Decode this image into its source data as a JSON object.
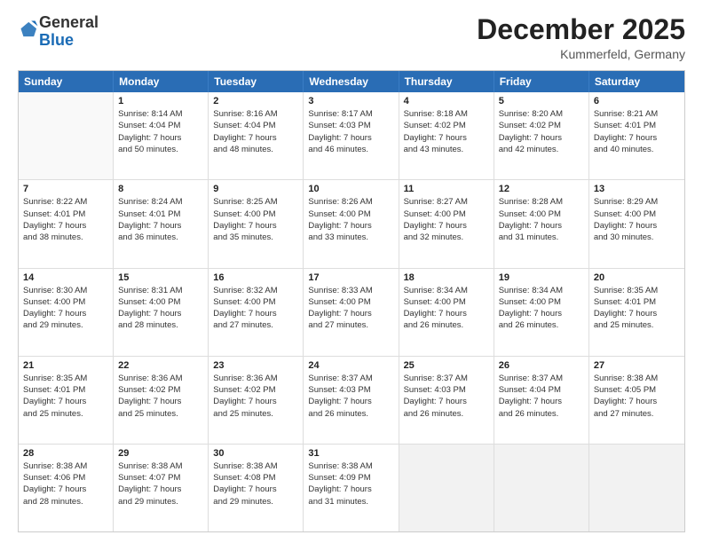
{
  "logo": {
    "general": "General",
    "blue": "Blue"
  },
  "title": "December 2025",
  "subtitle": "Kummerfeld, Germany",
  "header_days": [
    "Sunday",
    "Monday",
    "Tuesday",
    "Wednesday",
    "Thursday",
    "Friday",
    "Saturday"
  ],
  "weeks": [
    [
      {
        "day": "",
        "info": ""
      },
      {
        "day": "1",
        "info": "Sunrise: 8:14 AM\nSunset: 4:04 PM\nDaylight: 7 hours\nand 50 minutes."
      },
      {
        "day": "2",
        "info": "Sunrise: 8:16 AM\nSunset: 4:04 PM\nDaylight: 7 hours\nand 48 minutes."
      },
      {
        "day": "3",
        "info": "Sunrise: 8:17 AM\nSunset: 4:03 PM\nDaylight: 7 hours\nand 46 minutes."
      },
      {
        "day": "4",
        "info": "Sunrise: 8:18 AM\nSunset: 4:02 PM\nDaylight: 7 hours\nand 43 minutes."
      },
      {
        "day": "5",
        "info": "Sunrise: 8:20 AM\nSunset: 4:02 PM\nDaylight: 7 hours\nand 42 minutes."
      },
      {
        "day": "6",
        "info": "Sunrise: 8:21 AM\nSunset: 4:01 PM\nDaylight: 7 hours\nand 40 minutes."
      }
    ],
    [
      {
        "day": "7",
        "info": "Sunrise: 8:22 AM\nSunset: 4:01 PM\nDaylight: 7 hours\nand 38 minutes."
      },
      {
        "day": "8",
        "info": "Sunrise: 8:24 AM\nSunset: 4:01 PM\nDaylight: 7 hours\nand 36 minutes."
      },
      {
        "day": "9",
        "info": "Sunrise: 8:25 AM\nSunset: 4:00 PM\nDaylight: 7 hours\nand 35 minutes."
      },
      {
        "day": "10",
        "info": "Sunrise: 8:26 AM\nSunset: 4:00 PM\nDaylight: 7 hours\nand 33 minutes."
      },
      {
        "day": "11",
        "info": "Sunrise: 8:27 AM\nSunset: 4:00 PM\nDaylight: 7 hours\nand 32 minutes."
      },
      {
        "day": "12",
        "info": "Sunrise: 8:28 AM\nSunset: 4:00 PM\nDaylight: 7 hours\nand 31 minutes."
      },
      {
        "day": "13",
        "info": "Sunrise: 8:29 AM\nSunset: 4:00 PM\nDaylight: 7 hours\nand 30 minutes."
      }
    ],
    [
      {
        "day": "14",
        "info": "Sunrise: 8:30 AM\nSunset: 4:00 PM\nDaylight: 7 hours\nand 29 minutes."
      },
      {
        "day": "15",
        "info": "Sunrise: 8:31 AM\nSunset: 4:00 PM\nDaylight: 7 hours\nand 28 minutes."
      },
      {
        "day": "16",
        "info": "Sunrise: 8:32 AM\nSunset: 4:00 PM\nDaylight: 7 hours\nand 27 minutes."
      },
      {
        "day": "17",
        "info": "Sunrise: 8:33 AM\nSunset: 4:00 PM\nDaylight: 7 hours\nand 27 minutes."
      },
      {
        "day": "18",
        "info": "Sunrise: 8:34 AM\nSunset: 4:00 PM\nDaylight: 7 hours\nand 26 minutes."
      },
      {
        "day": "19",
        "info": "Sunrise: 8:34 AM\nSunset: 4:00 PM\nDaylight: 7 hours\nand 26 minutes."
      },
      {
        "day": "20",
        "info": "Sunrise: 8:35 AM\nSunset: 4:01 PM\nDaylight: 7 hours\nand 25 minutes."
      }
    ],
    [
      {
        "day": "21",
        "info": "Sunrise: 8:35 AM\nSunset: 4:01 PM\nDaylight: 7 hours\nand 25 minutes."
      },
      {
        "day": "22",
        "info": "Sunrise: 8:36 AM\nSunset: 4:02 PM\nDaylight: 7 hours\nand 25 minutes."
      },
      {
        "day": "23",
        "info": "Sunrise: 8:36 AM\nSunset: 4:02 PM\nDaylight: 7 hours\nand 25 minutes."
      },
      {
        "day": "24",
        "info": "Sunrise: 8:37 AM\nSunset: 4:03 PM\nDaylight: 7 hours\nand 26 minutes."
      },
      {
        "day": "25",
        "info": "Sunrise: 8:37 AM\nSunset: 4:03 PM\nDaylight: 7 hours\nand 26 minutes."
      },
      {
        "day": "26",
        "info": "Sunrise: 8:37 AM\nSunset: 4:04 PM\nDaylight: 7 hours\nand 26 minutes."
      },
      {
        "day": "27",
        "info": "Sunrise: 8:38 AM\nSunset: 4:05 PM\nDaylight: 7 hours\nand 27 minutes."
      }
    ],
    [
      {
        "day": "28",
        "info": "Sunrise: 8:38 AM\nSunset: 4:06 PM\nDaylight: 7 hours\nand 28 minutes."
      },
      {
        "day": "29",
        "info": "Sunrise: 8:38 AM\nSunset: 4:07 PM\nDaylight: 7 hours\nand 29 minutes."
      },
      {
        "day": "30",
        "info": "Sunrise: 8:38 AM\nSunset: 4:08 PM\nDaylight: 7 hours\nand 29 minutes."
      },
      {
        "day": "31",
        "info": "Sunrise: 8:38 AM\nSunset: 4:09 PM\nDaylight: 7 hours\nand 31 minutes."
      },
      {
        "day": "",
        "info": ""
      },
      {
        "day": "",
        "info": ""
      },
      {
        "day": "",
        "info": ""
      }
    ]
  ]
}
